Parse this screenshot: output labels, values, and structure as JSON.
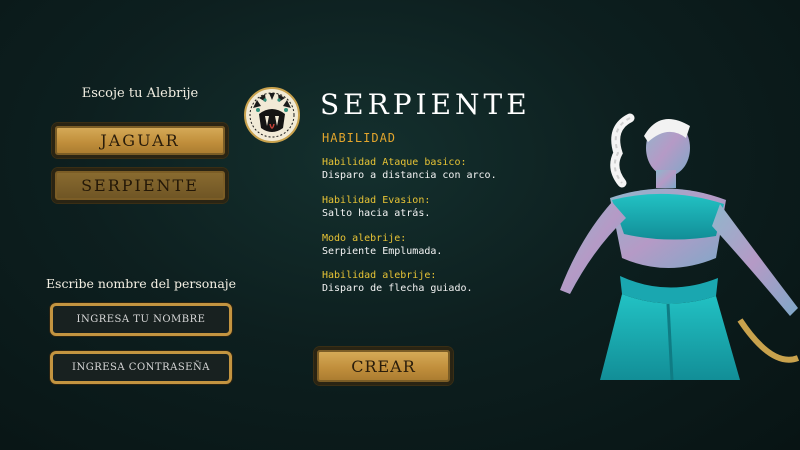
{
  "left": {
    "choose_heading": "Escoje tu Alebrije",
    "options": [
      "JAGUAR",
      "SERPIENTE"
    ],
    "name_heading": "Escribe nombre del personaje",
    "name_placeholder": "INGRESA TU NOMBRE",
    "password_placeholder": "INGRESA CONTRASEÑA"
  },
  "detail": {
    "title": "SERPIENTE",
    "section": "HABILIDAD",
    "skills": [
      {
        "label": "Habilidad Ataque basico:",
        "value": "Disparo a distancia con arco."
      },
      {
        "label": "Habilidad Evasion:",
        "value": "Salto hacia atrás."
      },
      {
        "label": "Modo alebrije:",
        "value": "Serpiente Emplumada."
      },
      {
        "label": "Habilidad alebrije:",
        "value": "Disparo de flecha guiado."
      }
    ],
    "create_label": "CREAR"
  },
  "colors": {
    "gold": "#c9993f",
    "label_yellow": "#e7c335",
    "section_orange": "#e2a52c",
    "character_teal": "#1fb3b8"
  },
  "icons": [
    "serpent-emblem-icon",
    "character-portrait"
  ]
}
